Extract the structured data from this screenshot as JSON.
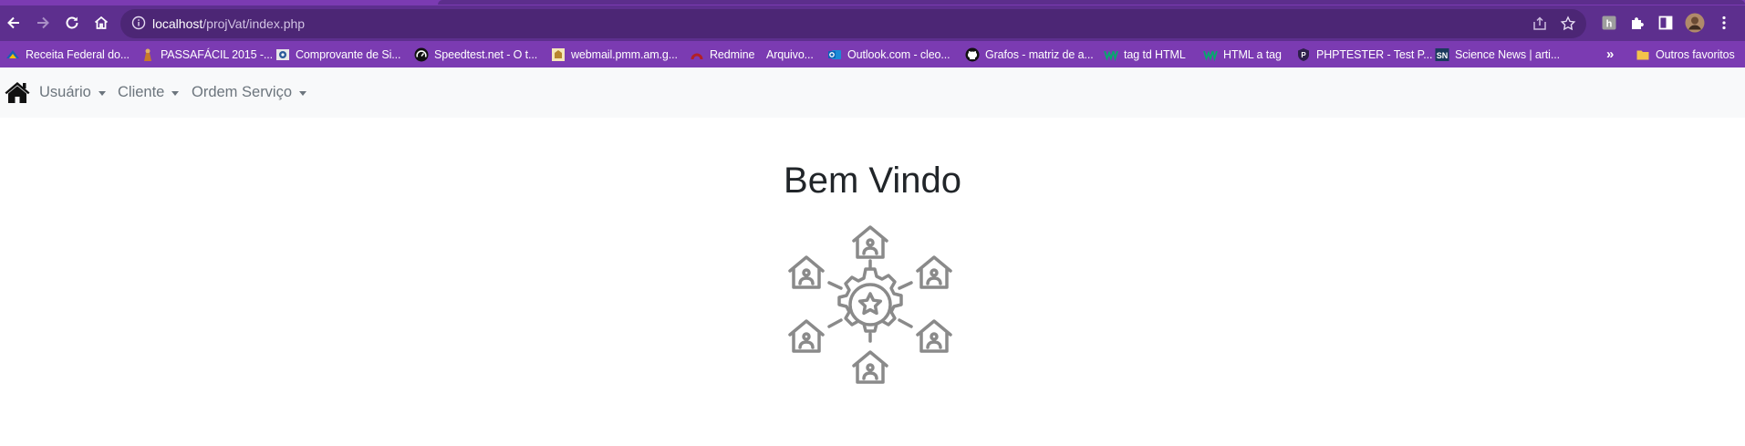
{
  "browser": {
    "url_host": "localhost",
    "url_path": "/projVat/index.php",
    "bookmarks": [
      {
        "label": "Receita Federal do...",
        "icon": "receita-icon"
      },
      {
        "label": "PASSAFÁCIL 2015 -...",
        "icon": "passafacil-icon"
      },
      {
        "label": "Comprovante de Si...",
        "icon": "comprovante-icon"
      },
      {
        "label": "Speedtest.net - O t...",
        "icon": "speedtest-icon"
      },
      {
        "label": "webmail.pmm.am.g...",
        "icon": "webmail-icon"
      },
      {
        "label": "Redmine",
        "icon": "redmine-icon"
      },
      {
        "label": "Arquivo...",
        "icon": ""
      },
      {
        "label": "Outlook.com - cleo...",
        "icon": "outlook-icon"
      },
      {
        "label": "Grafos - matriz de a...",
        "icon": "github-icon"
      },
      {
        "label": "tag td HTML",
        "icon": "w3schools-icon"
      },
      {
        "label": "HTML a tag",
        "icon": "w3schools-icon"
      },
      {
        "label": "PHPTESTER - Test P...",
        "icon": "phptester-icon"
      },
      {
        "label": "Science News | arti...",
        "icon": "sciencenews-icon"
      }
    ],
    "overflow_label": "»",
    "other_bookmarks_label": "Outros favoritos",
    "colors": {
      "toolbar": "#5d2f8e",
      "bookmarks_bar": "#7b3bb2",
      "omnibox": "#4c2675"
    }
  },
  "navbar": {
    "brand_icon": "home-icon",
    "items": [
      {
        "label": "Usuário"
      },
      {
        "label": "Cliente"
      },
      {
        "label": "Ordem Serviço"
      }
    ]
  },
  "main": {
    "heading": "Bem Vindo",
    "hero_icon": "network-gear-houses-icon"
  }
}
